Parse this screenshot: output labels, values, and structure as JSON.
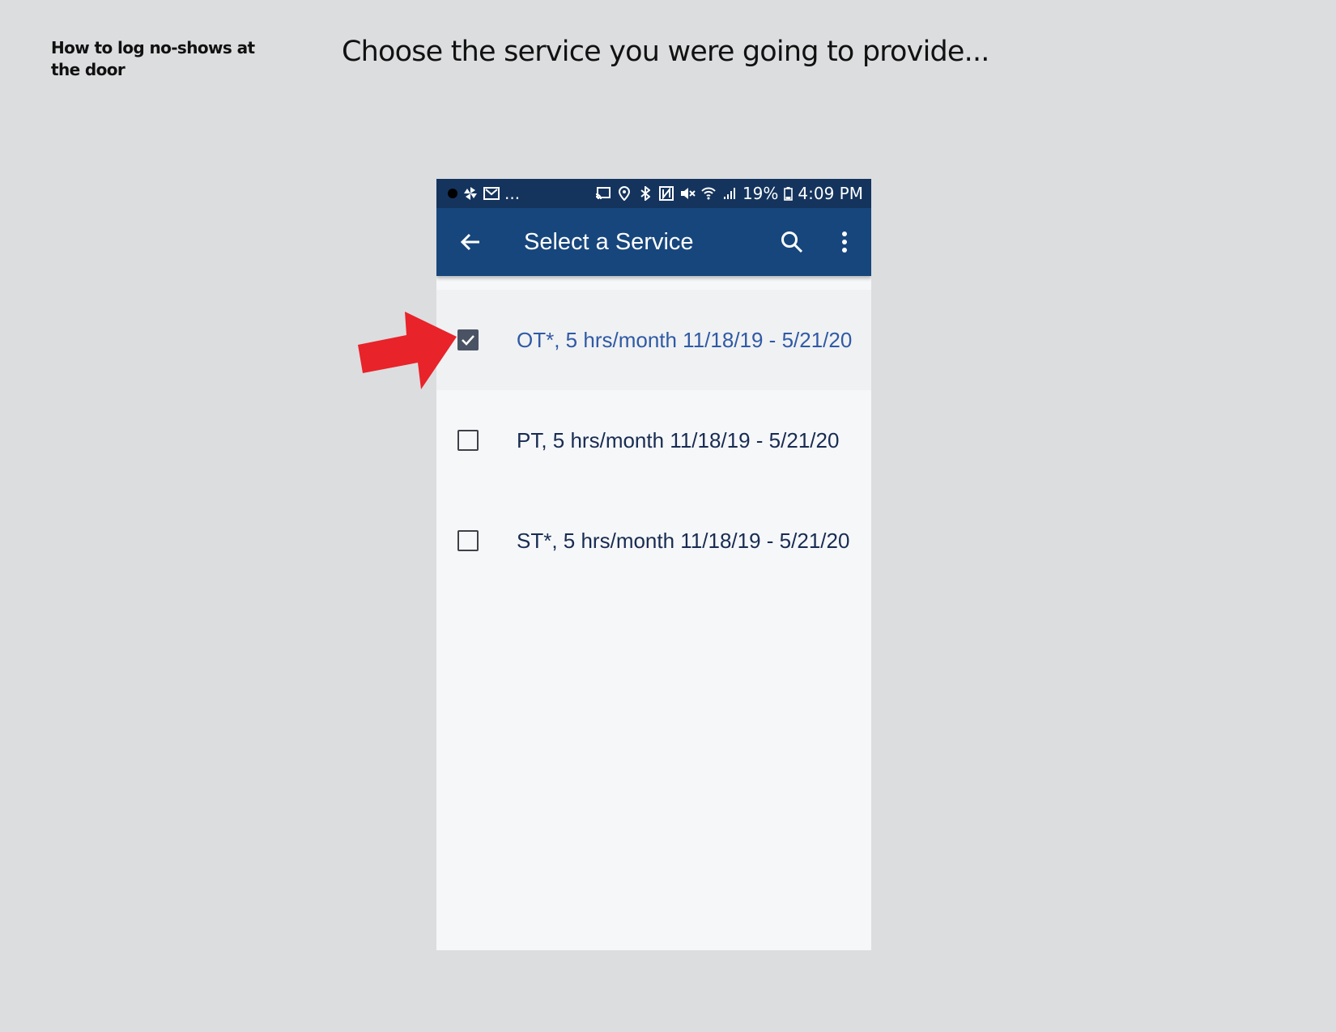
{
  "slide": {
    "subtitle": "How to log no-shows at the door",
    "title": "Choose the service you were going to provide..."
  },
  "status_bar": {
    "left_icons": [
      "recording-dot-icon",
      "pinwheel-icon",
      "mail-icon"
    ],
    "overflow": "...",
    "right_icons": [
      "cast-icon",
      "location-icon",
      "bluetooth-icon",
      "nfc-icon",
      "mute-icon",
      "wifi-icon",
      "signal-icon"
    ],
    "battery_percent": "19%",
    "time": "4:09 PM"
  },
  "app_bar": {
    "title": "Select a Service",
    "back_icon": "arrow-left-icon",
    "search_icon": "search-icon",
    "more_icon": "more-vertical-icon"
  },
  "services": [
    {
      "label": "OT*, 5 hrs/month 11/18/19 - 5/21/20",
      "checked": true
    },
    {
      "label": "PT, 5 hrs/month 11/18/19 - 5/21/20",
      "checked": false
    },
    {
      "label": "ST*, 5 hrs/month 11/18/19 - 5/21/20",
      "checked": false
    }
  ],
  "colors": {
    "page_bg": "#dcdddf",
    "status_bar": "#14345d",
    "app_bar": "#17467c",
    "selected_text": "#2f5aa5",
    "item_text": "#182c52",
    "arrow": "#e8232a"
  }
}
